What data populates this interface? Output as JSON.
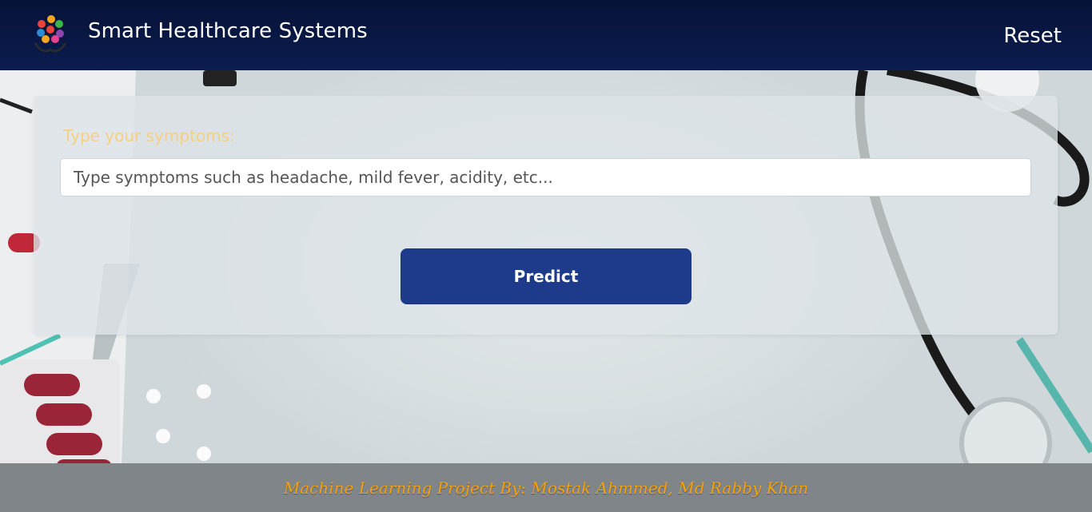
{
  "header": {
    "brand": "Smart Healthcare Systems",
    "logo_icon": "healthcare-hands-icon",
    "reset_label": "Reset",
    "background": "#0b1c4e"
  },
  "form": {
    "label": "Type your symptoms:",
    "input_placeholder": "Type symptoms such as headache, mild fever, acidity, etc...",
    "input_value": "",
    "predict_label": "Predict",
    "accent": "#1e3a8a",
    "label_color": "#f7cf82"
  },
  "footer": {
    "text": "Machine Learning Project By: Mostak Ahmmed, Md Rabby Khan",
    "text_color": "#f4a20e"
  }
}
